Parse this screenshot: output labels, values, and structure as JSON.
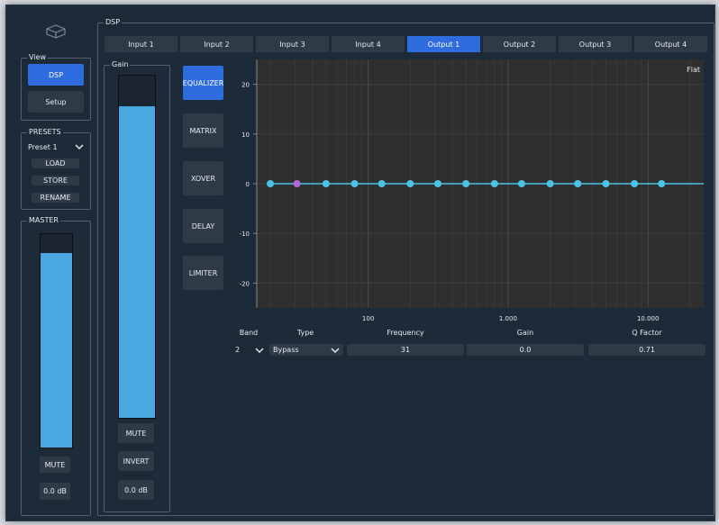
{
  "view": {
    "title": "View",
    "dsp_label": "DSP",
    "setup_label": "Setup"
  },
  "presets": {
    "title": "PRESETS",
    "selected": "Preset 1",
    "load_label": "LOAD",
    "store_label": "STORE",
    "rename_label": "RENAME"
  },
  "master": {
    "title": "MASTER",
    "mute_label": "MUTE",
    "gain_value": "0.0 dB",
    "level": 0.91
  },
  "dsp": {
    "title": "DSP",
    "tabs": [
      "Input 1",
      "Input 2",
      "Input 3",
      "Input 4",
      "Output 1",
      "Output 2",
      "Output 3",
      "Output 4"
    ],
    "active_tab": 4
  },
  "gain": {
    "title": "Gain",
    "level": 0.91,
    "mute_label": "MUTE",
    "invert_label": "INVERT",
    "value": "0.0 dB"
  },
  "modes": {
    "equalizer": "EQUALIZER",
    "matrix": "MATRIX",
    "xover": "XOVER",
    "delay": "DELAY",
    "limiter": "LIMITER"
  },
  "chart_data": {
    "type": "line",
    "title": "Flat",
    "xscale": "log",
    "xlim": [
      16,
      25000
    ],
    "ylim": [
      -25,
      25
    ],
    "x_ticks": [
      {
        "value": 100,
        "label": "100"
      },
      {
        "value": 1000,
        "label": "1.000"
      },
      {
        "value": 10000,
        "label": "10.000"
      }
    ],
    "y_ticks": [
      20,
      10,
      0,
      -10,
      -20
    ],
    "grid": true,
    "response_color": "#4cc3e6",
    "selected_color": "#b06ad8",
    "selected_index": 1,
    "bands": [
      {
        "freq": 20,
        "gain": 0
      },
      {
        "freq": 31,
        "gain": 0
      },
      {
        "freq": 50,
        "gain": 0
      },
      {
        "freq": 80,
        "gain": 0
      },
      {
        "freq": 125,
        "gain": 0
      },
      {
        "freq": 200,
        "gain": 0
      },
      {
        "freq": 315,
        "gain": 0
      },
      {
        "freq": 500,
        "gain": 0
      },
      {
        "freq": 800,
        "gain": 0
      },
      {
        "freq": 1250,
        "gain": 0
      },
      {
        "freq": 2000,
        "gain": 0
      },
      {
        "freq": 3150,
        "gain": 0
      },
      {
        "freq": 5000,
        "gain": 0
      },
      {
        "freq": 8000,
        "gain": 0
      },
      {
        "freq": 12500,
        "gain": 0
      }
    ]
  },
  "band_editor": {
    "headers": {
      "band": "Band",
      "type": "Type",
      "frequency": "Frequency",
      "gain": "Gain",
      "q": "Q Factor"
    },
    "band": "2",
    "type": "Bypass",
    "frequency": "31",
    "gain": "0.0",
    "q": "0.71"
  }
}
